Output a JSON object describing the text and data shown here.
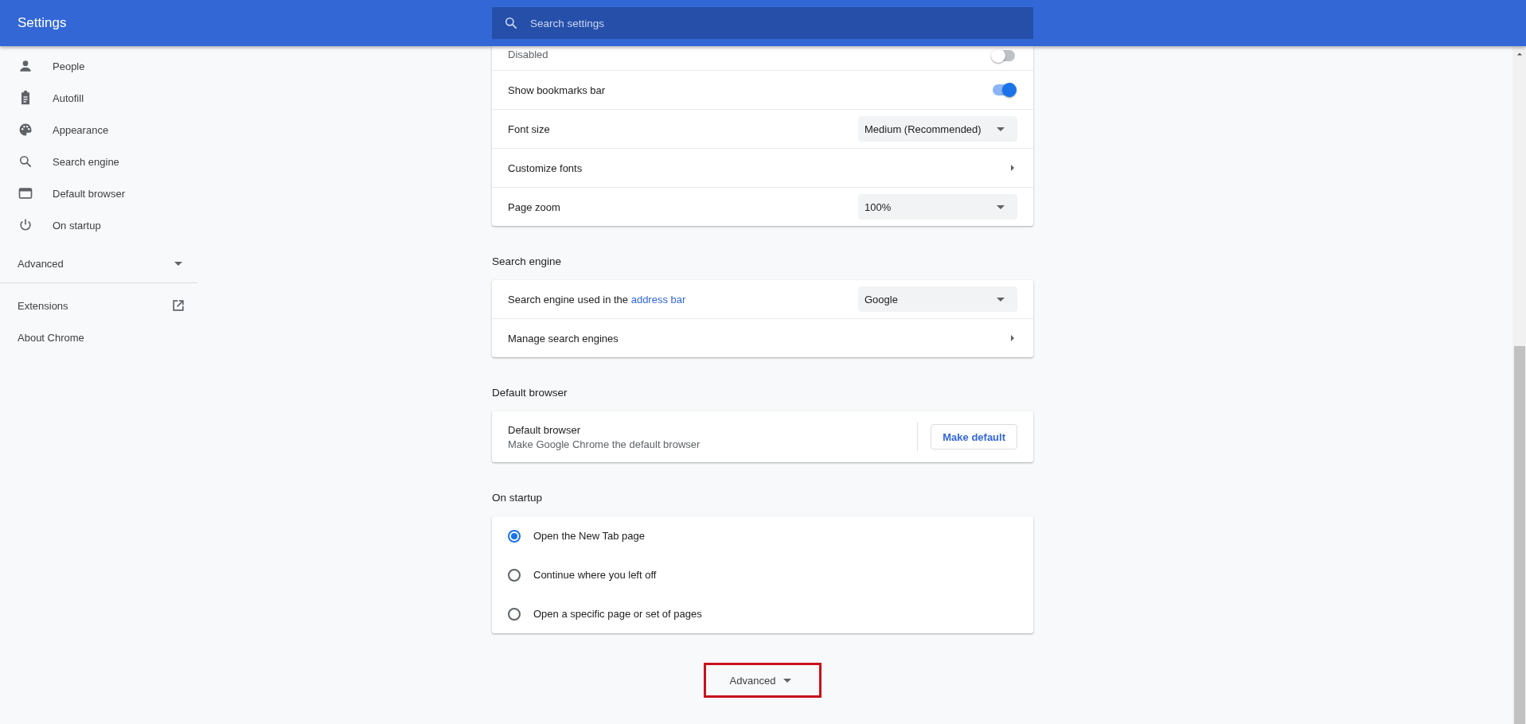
{
  "header": {
    "title": "Settings",
    "search": {
      "placeholder": "Search settings"
    }
  },
  "sidebar": {
    "items": [
      {
        "label": "People"
      },
      {
        "label": "Autofill"
      },
      {
        "label": "Appearance"
      },
      {
        "label": "Search engine"
      },
      {
        "label": "Default browser"
      },
      {
        "label": "On startup"
      }
    ],
    "advanced": {
      "label": "Advanced",
      "expanded": false
    },
    "links": [
      {
        "label": "Extensions",
        "external": true
      },
      {
        "label": "About Chrome",
        "external": false
      }
    ]
  },
  "sections": [
    {
      "rows": [
        {
          "kind": "toggle",
          "sublabel": "Disabled",
          "on": false
        },
        {
          "kind": "toggle",
          "label": "Show bookmarks bar",
          "on": true
        },
        {
          "kind": "select",
          "label": "Font size",
          "value": "Medium (Recommended)"
        },
        {
          "kind": "link",
          "label": "Customize fonts"
        },
        {
          "kind": "select",
          "label": "Page zoom",
          "value": "100%"
        }
      ]
    },
    {
      "heading": "Search engine",
      "rows": [
        {
          "kind": "select",
          "label": "Search engine used in the ",
          "link": "address bar",
          "value": "Google"
        },
        {
          "kind": "link",
          "label": "Manage search engines"
        }
      ]
    },
    {
      "heading": "Default browser",
      "rows": [
        {
          "kind": "button",
          "label": "Default browser",
          "sublabel": "Make Google Chrome the default browser",
          "button": "Make default"
        }
      ]
    },
    {
      "heading": "On startup",
      "rows": [
        {
          "kind": "radio",
          "label": "Open the New Tab page",
          "selected": true
        },
        {
          "kind": "radio",
          "label": "Continue where you left off",
          "selected": false
        },
        {
          "kind": "radio",
          "label": "Open a specific page or set of pages",
          "selected": false
        }
      ]
    }
  ],
  "advanced_button": {
    "label": "Advanced",
    "expanded": false
  }
}
